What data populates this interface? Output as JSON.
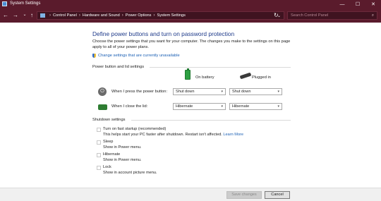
{
  "window": {
    "title": "System Settings",
    "controls": [
      "—",
      "☐",
      "✕"
    ]
  },
  "nav": {
    "back": "←",
    "forward": "→",
    "recent": "⌄",
    "up": "↑",
    "breadcrumbs": [
      "Control Panel",
      "Hardware and Sound",
      "Power Options",
      "System Settings"
    ],
    "dropdown": "⌄",
    "refresh": "↻",
    "search_placeholder": "Search Control Panel"
  },
  "main": {
    "heading": "Define power buttons and turn on password protection",
    "description": "Choose the power settings that you want for your computer. The changes you make to the settings on this page apply to all of your power plans.",
    "admin_link": "Change settings that are currently unavailable",
    "power_section": {
      "label": "Power button and lid settings",
      "col_battery": "On battery",
      "col_plugged": "Plugged in",
      "rows": [
        {
          "label": "When I press the power button:",
          "battery": "Shut down",
          "plugged": "Shut down"
        },
        {
          "label": "When I close the lid:",
          "battery": "Hibernate",
          "plugged": "Hibernate"
        }
      ]
    },
    "shutdown_section": {
      "label": "Shutdown settings",
      "items": [
        {
          "title": "Turn on fast startup (recommended)",
          "sub": "This helps start your PC faster after shutdown. Restart isn't affected.",
          "link": "Learn More"
        },
        {
          "title": "Sleep",
          "sub": "Show in Power menu."
        },
        {
          "title": "Hibernate",
          "sub": "Show in Power menu."
        },
        {
          "title": "Lock",
          "sub": "Show in account picture menu."
        }
      ]
    }
  },
  "footer": {
    "save": "Save changes",
    "cancel": "Cancel"
  },
  "icons": {
    "power": "⏻",
    "caret": "▾",
    "search": "⌕"
  }
}
